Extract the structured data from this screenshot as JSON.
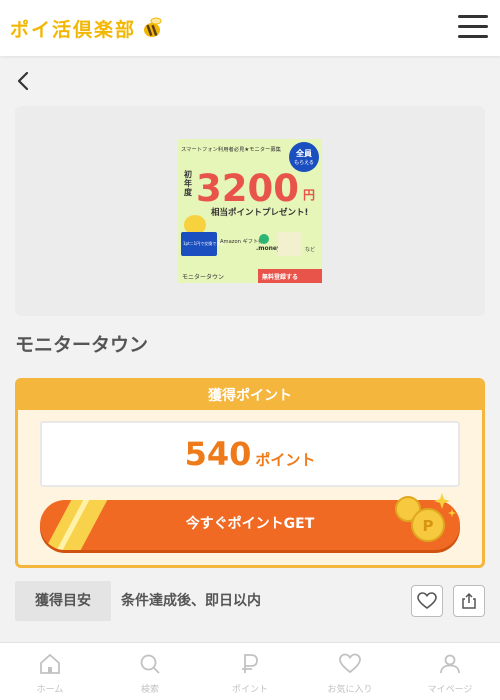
{
  "header": {
    "logo_text": "ポイ活倶楽部"
  },
  "banner": {
    "top_line": "スマートフォン利用者必見★モニター募集",
    "badge_line1": "全員",
    "badge_line2": "もらえる",
    "first_year": "初年度",
    "amount": "3200",
    "yen": "円",
    "subline": "相当ポイントプレゼント!",
    "exchange_badge": "1pt＝1円で交換できる",
    "logo_amazon": "Amazon ギフト券",
    "logo_money": ".money",
    "logo_other": "など",
    "footer_left": "モニタータウン",
    "footer_cta": "無料登録する"
  },
  "offer": {
    "title": "モニタータウン"
  },
  "points": {
    "heading": "獲得ポイント",
    "value": "540",
    "unit": "ポイント",
    "get_button": "今すぐポイントGET"
  },
  "estimate": {
    "label": "獲得目安",
    "value": "条件達成後、即日以内"
  },
  "bottom_nav": {
    "items": [
      {
        "label": "ホーム",
        "icon": "home-icon"
      },
      {
        "label": "検索",
        "icon": "search-icon"
      },
      {
        "label": "ポイント",
        "icon": "point-icon"
      },
      {
        "label": "お気に入り",
        "icon": "heart-icon"
      },
      {
        "label": "マイページ",
        "icon": "user-icon"
      }
    ]
  },
  "colors": {
    "accent_orange": "#f06a24",
    "point_orange": "#ee7a1a",
    "box_border": "#f5b63e",
    "logo_yellow": "#f2b705"
  }
}
